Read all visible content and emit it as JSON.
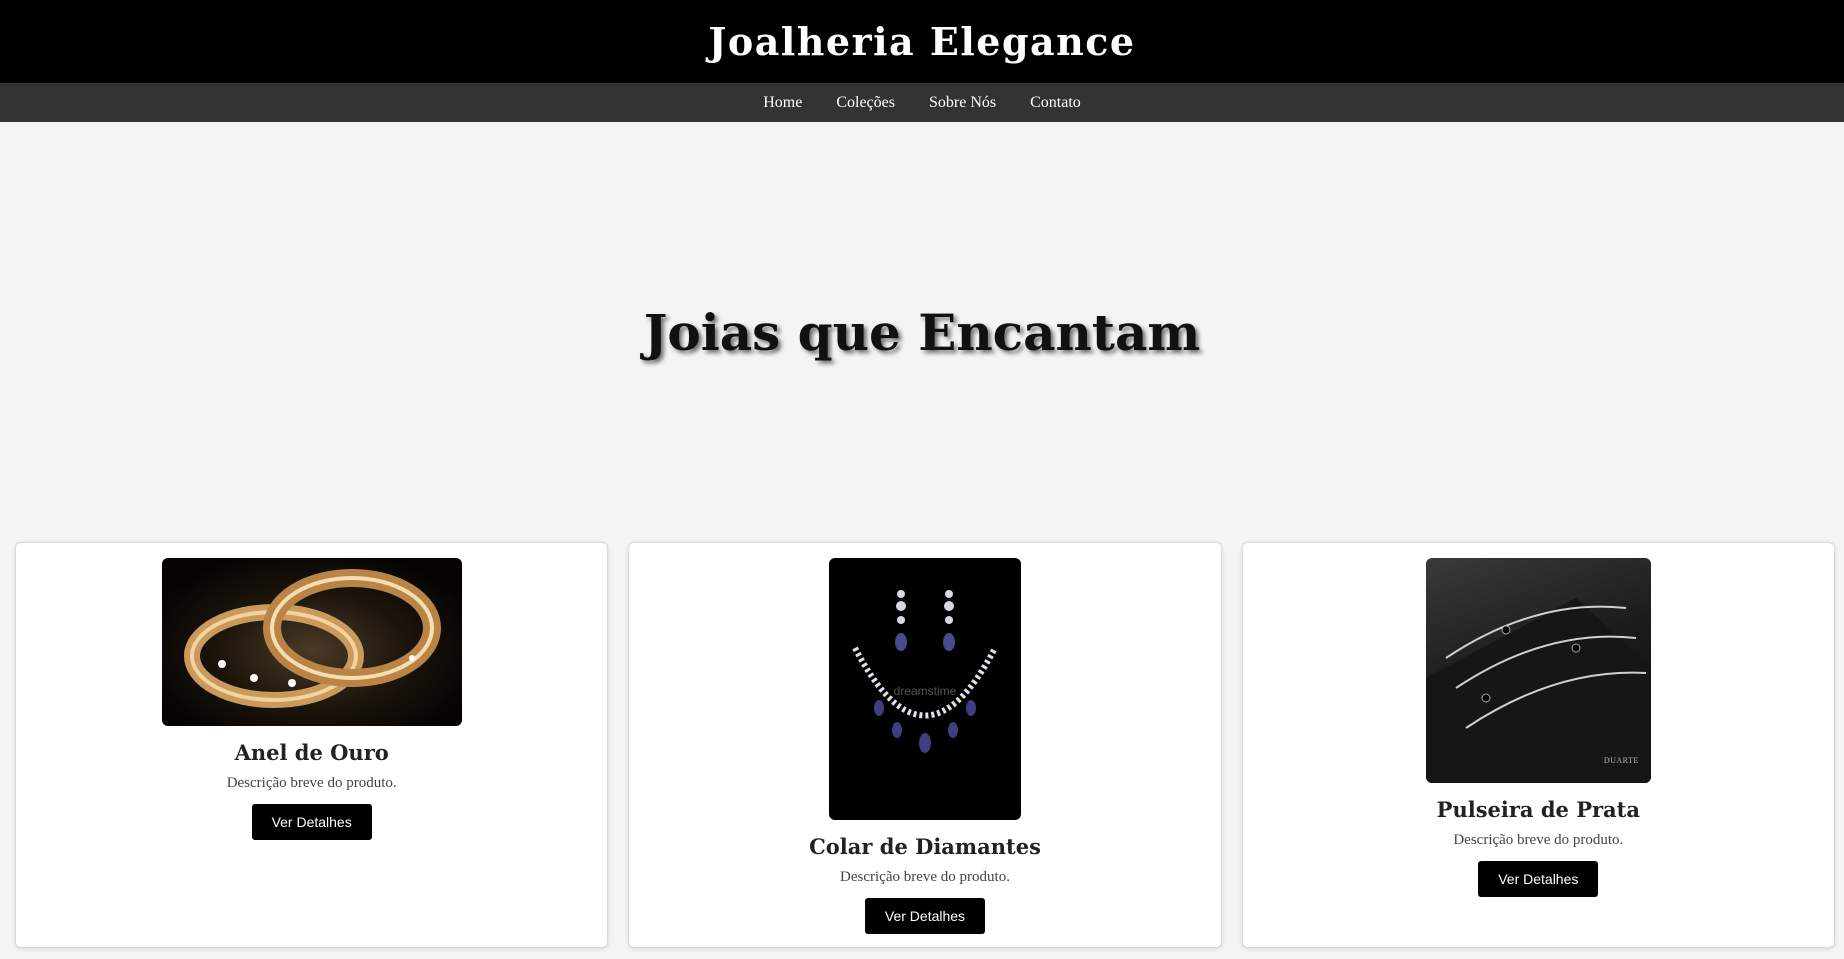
{
  "header": {
    "title": "Joalheria Elegance"
  },
  "nav": {
    "items": [
      "Home",
      "Coleções",
      "Sobre Nós",
      "Contato"
    ]
  },
  "hero": {
    "title": "Joias que Encantam"
  },
  "products": [
    {
      "name": "Anel de Ouro",
      "description": "Descrição breve do produto.",
      "button": "Ver Detalhes",
      "image": "gold-rings"
    },
    {
      "name": "Colar de Diamantes",
      "description": "Descrição breve do produto.",
      "button": "Ver Detalhes",
      "image": "diamond-necklace",
      "watermark": "dreamstime"
    },
    {
      "name": "Pulseira de Prata",
      "description": "Descrição breve do produto.",
      "button": "Ver Detalhes",
      "image": "silver-bracelet",
      "watermark": "DUARTE"
    }
  ],
  "colors": {
    "header_bg": "#000000",
    "nav_bg": "#333333",
    "page_bg": "#f4f4f4",
    "button_bg": "#000000"
  }
}
